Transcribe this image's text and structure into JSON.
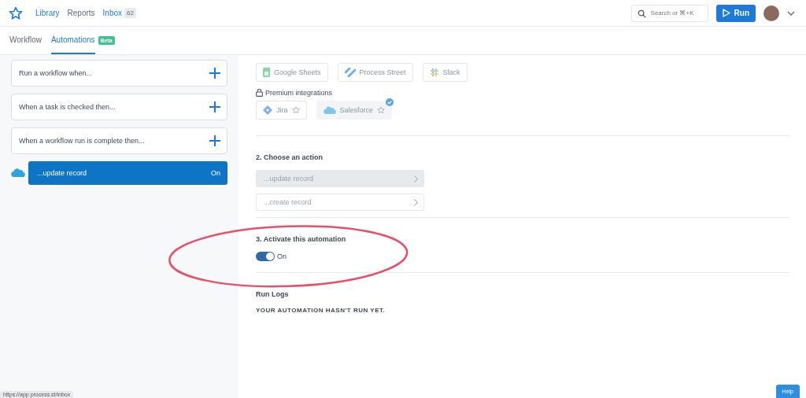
{
  "nav": {
    "links": [
      {
        "label": "Library",
        "selected": true
      },
      {
        "label": "Reports",
        "selected": false
      },
      {
        "label": "Inbox",
        "selected": true,
        "badge": "62"
      }
    ],
    "search": {
      "placeholder": "Search or ⌘+K"
    },
    "run_button": "Run"
  },
  "tabs": [
    {
      "label": "Workflow",
      "selected": false
    },
    {
      "label": "Automations",
      "selected": true,
      "badge": "Beta"
    }
  ],
  "sidebar": {
    "triggers": [
      "Run a workflow when...",
      "When a task is checked then...",
      "When a workflow run is complete then..."
    ],
    "automation": {
      "label": "...update record",
      "status": "On"
    }
  },
  "integrations": {
    "apps": [
      {
        "kind": "sheets",
        "label": "Google Sheets"
      },
      {
        "kind": "process-street",
        "label": "Process Street"
      },
      {
        "kind": "slack",
        "label": "Slack"
      }
    ],
    "premium_label": "Premium integrations",
    "premium": [
      {
        "kind": "jira",
        "label": "Jira",
        "selected": false
      },
      {
        "kind": "salesforce",
        "label": "Salesforce",
        "selected": true
      }
    ]
  },
  "action": {
    "title": "2. Choose an action",
    "options": [
      {
        "label": "...update record",
        "selected": true
      },
      {
        "label": "...create record",
        "selected": false
      }
    ]
  },
  "activate": {
    "title": "3. Activate this automation",
    "on": true,
    "label": "On"
  },
  "run_logs": {
    "title": "Run Logs",
    "message": "YOUR AUTOMATION HASN'T RUN YET."
  },
  "help": "Help",
  "status_url": "https://app.process.st/inbox"
}
